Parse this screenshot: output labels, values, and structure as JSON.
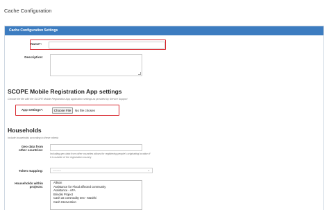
{
  "page": {
    "title": "Cache Configuration"
  },
  "panel": {
    "header": "Cache Configuration Settings"
  },
  "fields": {
    "name_label": "Name*:",
    "name_value": "",
    "description_label": "Description:",
    "description_value": ""
  },
  "scope": {
    "title": "SCOPE Mobile Registration App settings",
    "desc": "Choose the file with the SCOPE Mobile Registration App application settings as provided by Service Support",
    "app_settings_label": "App settings*:",
    "choose_file_label": "Choose File",
    "file_status": "No file chosen"
  },
  "households": {
    "title": "Households",
    "desc": "Include households according to these criteria",
    "geo_label_line1": "Geo data from",
    "geo_label_line2": "other countries:",
    "geo_help": "Including geo data from other countries allows for registering people's originating location if it is outside of the registration country",
    "token_label": "Token mapping:",
    "token_value": "---------",
    "projects_label_line1": "Households within",
    "projects_label_line2": "projects:",
    "projects": [
      "Allison",
      "Assistance for Flood affected community",
      "Assistance - AFA",
      "Brindisi Project",
      "Cash as commodity test - Manithi",
      "Cash Intervention"
    ]
  },
  "colors": {
    "header_bg": "#3c7cc0",
    "highlight": "#d8282f"
  }
}
